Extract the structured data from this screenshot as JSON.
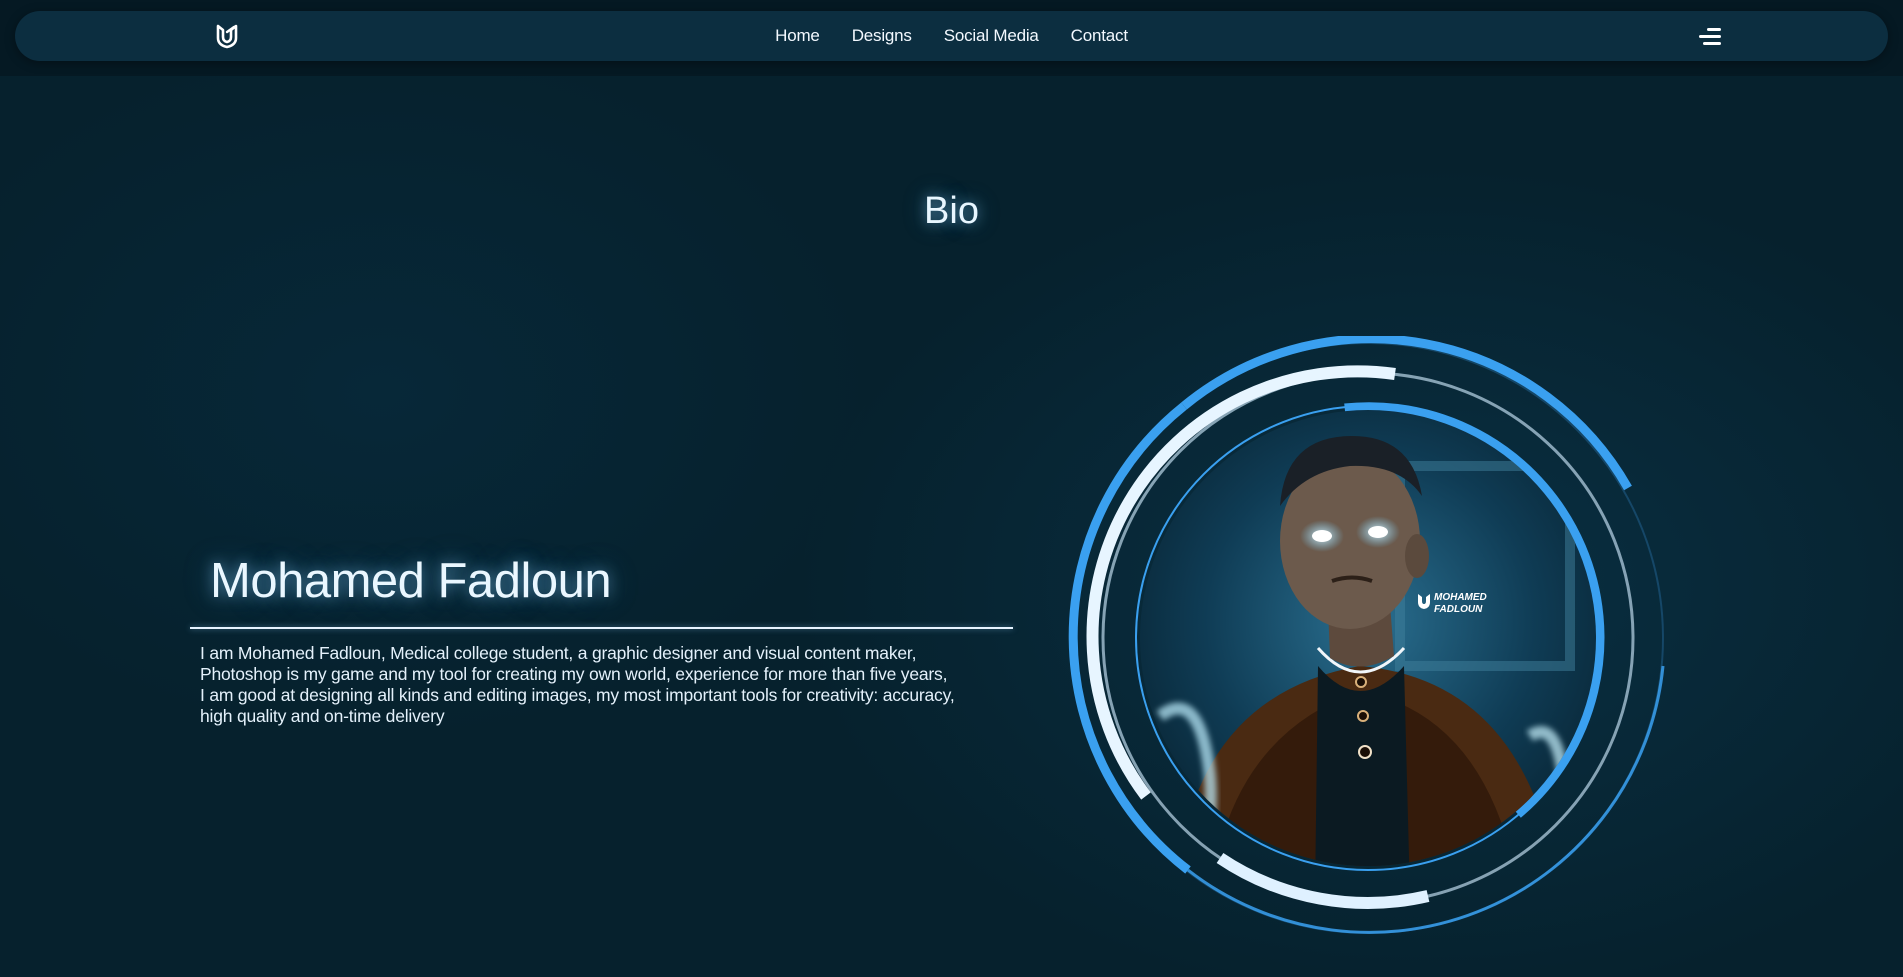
{
  "nav": {
    "logo_icon": "monogram-logo-icon",
    "links": [
      "Home",
      "Designs",
      "Social Media",
      "Contact"
    ],
    "menu_icon": "hamburger-menu-icon"
  },
  "section": {
    "title": "Bio"
  },
  "profile": {
    "name": "Mohamed Fadloun",
    "bio_lines": [
      "I am Mohamed Fadloun, Medical college student, a graphic designer and visual content maker,",
      "Photoshop is my game and my tool for creating my own world, experience for more than five years,",
      "I am good at designing all kinds and editing images, my most important tools for creativity: accuracy,",
      "high quality and on-time delivery"
    ],
    "portrait_watermark": [
      "MOHAMED",
      "FADLOUN"
    ]
  },
  "colors": {
    "background": "#06212d",
    "navbar": "#0c2e40",
    "accent_blue": "#3aa0f0",
    "ring_light": "#cfeaff"
  }
}
